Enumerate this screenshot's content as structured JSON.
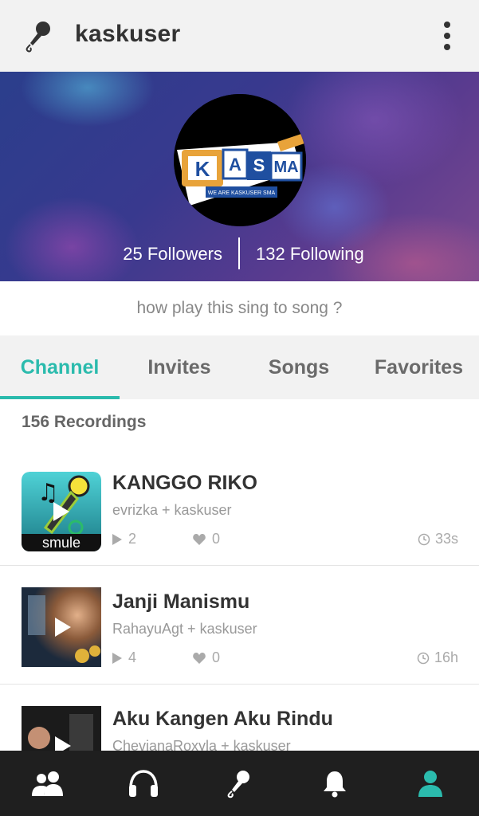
{
  "header": {
    "title": "kaskuser",
    "mic_icon": "microphone-icon",
    "menu_icon": "more-vert-icon"
  },
  "profile": {
    "followers": "25 Followers",
    "following": "132 Following",
    "avatar_logo": "KASMA",
    "avatar_tagline": "WE ARE KASKUSER SMA"
  },
  "bio": "how play this sing to song ?",
  "tabs": [
    {
      "label": "Channel",
      "active": true
    },
    {
      "label": "Invites"
    },
    {
      "label": "Songs"
    },
    {
      "label": "Favorites"
    }
  ],
  "recordings_count": "156 Recordings",
  "recordings": [
    {
      "title": "KANGGO RIKO",
      "artists": "evrizka + kaskuser",
      "plays": "2",
      "likes": "0",
      "duration": "33s",
      "thumb_brand": "smule"
    },
    {
      "title": "Janji Manismu",
      "artists": "RahayuAgt + kaskuser",
      "plays": "4",
      "likes": "0",
      "duration": "16h"
    },
    {
      "title": "Aku Kangen Aku Rindu",
      "artists": "ChevianaRoxyla + kaskuser"
    }
  ],
  "bottom_nav": [
    {
      "icon": "people-icon"
    },
    {
      "icon": "headphones-icon"
    },
    {
      "icon": "microphone-icon"
    },
    {
      "icon": "bell-icon"
    },
    {
      "icon": "profile-icon",
      "active": true
    }
  ],
  "colors": {
    "accent": "#2bbbad",
    "nav_bg": "#1f1f1f",
    "topbar_bg": "#f2f2f2"
  }
}
